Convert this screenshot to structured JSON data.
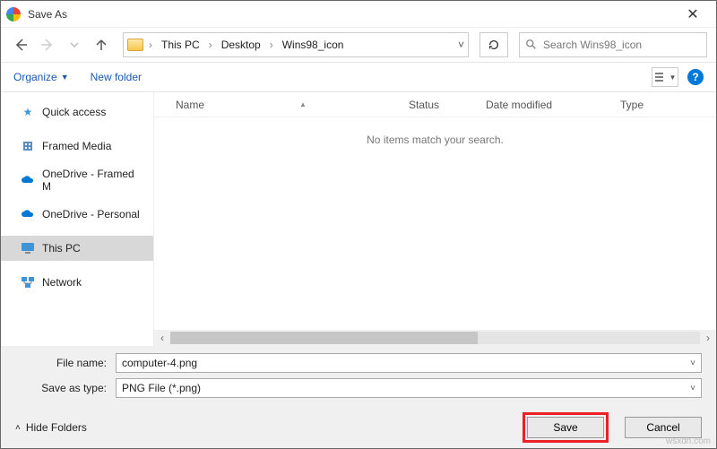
{
  "window": {
    "title": "Save As"
  },
  "breadcrumb": {
    "root": "This PC",
    "level1": "Desktop",
    "level2": "Wins98_icon"
  },
  "search": {
    "placeholder": "Search Wins98_icon"
  },
  "toolbar": {
    "organize": "Organize",
    "newfolder": "New folder"
  },
  "sidebar": {
    "items": [
      {
        "label": "Quick access"
      },
      {
        "label": "Framed Media"
      },
      {
        "label": "OneDrive - Framed M"
      },
      {
        "label": "OneDrive - Personal"
      },
      {
        "label": "This PC"
      },
      {
        "label": "Network"
      }
    ]
  },
  "columns": {
    "name": "Name",
    "status": "Status",
    "modified": "Date modified",
    "type": "Type"
  },
  "empty_msg": "No items match your search.",
  "form": {
    "filename_label": "File name:",
    "filename_value": "computer-4.png",
    "type_label": "Save as type:",
    "type_value": "PNG File (*.png)"
  },
  "footer": {
    "hide": "Hide Folders",
    "save": "Save",
    "cancel": "Cancel"
  },
  "watermark": "wsxdn.com"
}
